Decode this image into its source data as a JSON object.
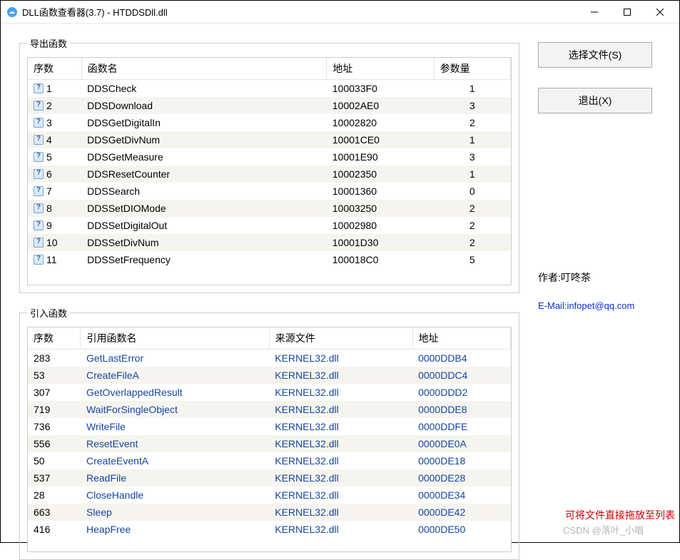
{
  "window": {
    "title": "DLL函数查看器(3.7) - HTDDSDll.dll"
  },
  "buttons": {
    "select_file": "选择文件(S)",
    "exit": "退出(X)"
  },
  "export_group": {
    "legend": "导出函数",
    "headers": {
      "idx": "序数",
      "name": "函数名",
      "addr": "地址",
      "argc": "参数量"
    },
    "rows": [
      {
        "idx": "1",
        "name": "DDSCheck",
        "addr": "100033F0",
        "argc": "1"
      },
      {
        "idx": "2",
        "name": "DDSDownload",
        "addr": "10002AE0",
        "argc": "3"
      },
      {
        "idx": "3",
        "name": "DDSGetDigitalIn",
        "addr": "10002820",
        "argc": "2"
      },
      {
        "idx": "4",
        "name": "DDSGetDivNum",
        "addr": "10001CE0",
        "argc": "1"
      },
      {
        "idx": "5",
        "name": "DDSGetMeasure",
        "addr": "10001E90",
        "argc": "3"
      },
      {
        "idx": "6",
        "name": "DDSResetCounter",
        "addr": "10002350",
        "argc": "1"
      },
      {
        "idx": "7",
        "name": "DDSSearch",
        "addr": "10001360",
        "argc": "0"
      },
      {
        "idx": "8",
        "name": "DDSSetDIOMode",
        "addr": "10003250",
        "argc": "2"
      },
      {
        "idx": "9",
        "name": "DDSSetDigitalOut",
        "addr": "10002980",
        "argc": "2"
      },
      {
        "idx": "10",
        "name": "DDSSetDivNum",
        "addr": "10001D30",
        "argc": "2"
      },
      {
        "idx": "11",
        "name": "DDSSetFrequency",
        "addr": "100018C0",
        "argc": "5"
      }
    ]
  },
  "import_group": {
    "legend": "引入函数",
    "headers": {
      "idx": "序数",
      "name": "引用函数名",
      "src": "来源文件",
      "addr": "地址"
    },
    "rows": [
      {
        "idx": "283",
        "name": "GetLastError",
        "src": "KERNEL32.dll",
        "addr": "0000DDB4"
      },
      {
        "idx": "53",
        "name": "CreateFileA",
        "src": "KERNEL32.dll",
        "addr": "0000DDC4"
      },
      {
        "idx": "307",
        "name": "GetOverlappedResult",
        "src": "KERNEL32.dll",
        "addr": "0000DDD2"
      },
      {
        "idx": "719",
        "name": "WaitForSingleObject",
        "src": "KERNEL32.dll",
        "addr": "0000DDE8"
      },
      {
        "idx": "736",
        "name": "WriteFile",
        "src": "KERNEL32.dll",
        "addr": "0000DDFE"
      },
      {
        "idx": "556",
        "name": "ResetEvent",
        "src": "KERNEL32.dll",
        "addr": "0000DE0A"
      },
      {
        "idx": "50",
        "name": "CreateEventA",
        "src": "KERNEL32.dll",
        "addr": "0000DE18"
      },
      {
        "idx": "537",
        "name": "ReadFile",
        "src": "KERNEL32.dll",
        "addr": "0000DE28"
      },
      {
        "idx": "28",
        "name": "CloseHandle",
        "src": "KERNEL32.dll",
        "addr": "0000DE34"
      },
      {
        "idx": "663",
        "name": "Sleep",
        "src": "KERNEL32.dll",
        "addr": "0000DE42"
      },
      {
        "idx": "416",
        "name": "HeapFree",
        "src": "KERNEL32.dll",
        "addr": "0000DE50"
      }
    ]
  },
  "sidebar": {
    "author_label": "作者:叮咚茶",
    "email_label": "E-Mail:infopet@qq.com",
    "hint": "可将文件直接拖放至列表",
    "watermark": "CSDN @落叶_小唱"
  }
}
